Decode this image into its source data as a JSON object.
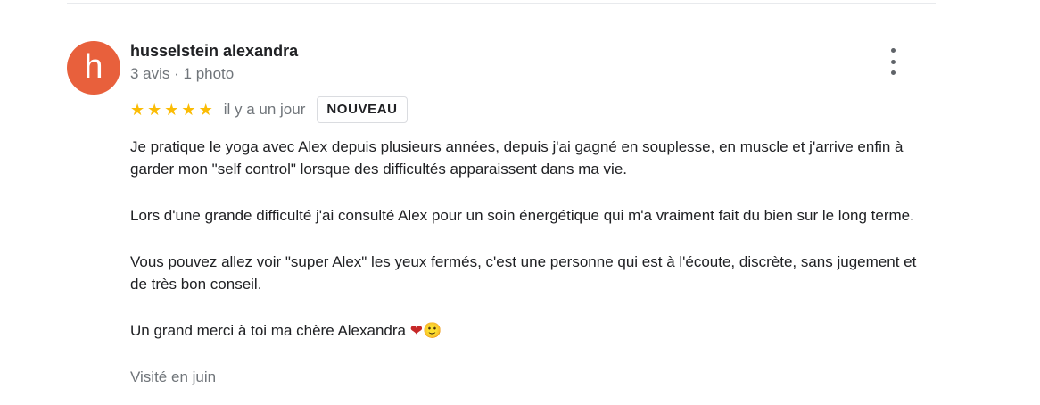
{
  "review": {
    "avatar_letter": "h",
    "author_name": "husselstein alexandra",
    "author_meta": "3 avis · 1 photo",
    "rating": 5,
    "stars": [
      "★",
      "★",
      "★",
      "★",
      "★"
    ],
    "time": "il y a un jour",
    "badge": "NOUVEAU",
    "paragraphs": [
      "Je pratique le yoga avec Alex depuis plusieurs années, depuis j'ai gagné en souplesse, en muscle et j'arrive enfin à garder mon \"self control\" lorsque des difficultés apparaissent dans ma vie.",
      "Lors d'une grande difficulté j'ai consulté Alex pour un soin énergétique qui m'a vraiment fait du bien sur le long terme.",
      "Vous pouvez allez voir \"super Alex\" les yeux fermés, c'est une personne qui est à l'écoute, discrète, sans jugement et de très bon conseil.",
      "Un grand merci à toi ma chère Alexandra"
    ],
    "emojis": [
      "❤",
      "🙂"
    ],
    "visited": "Visité en juin"
  },
  "icons": {
    "avatar_color": "#e8603c",
    "star_color": "#fbbc04",
    "menu": "more-vert-icon"
  }
}
